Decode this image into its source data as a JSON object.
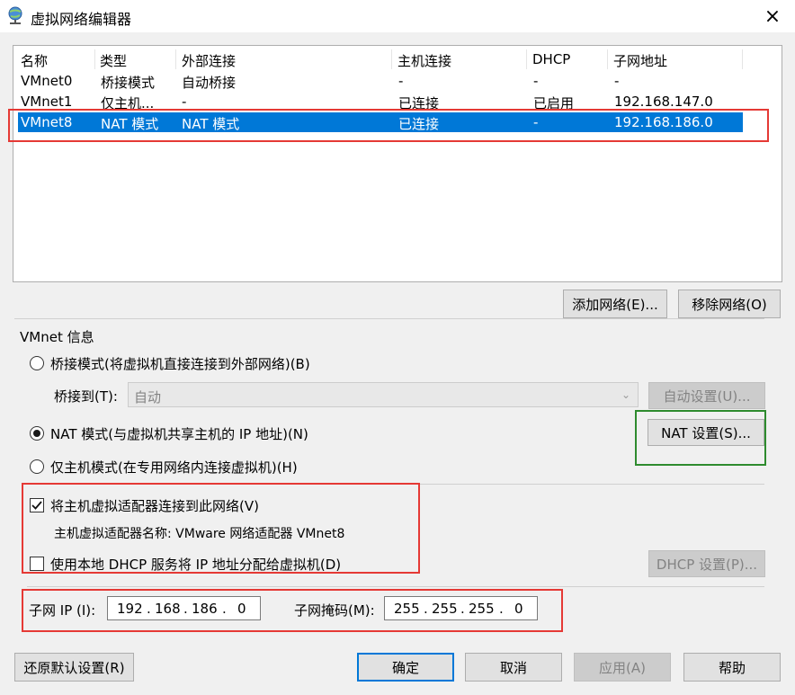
{
  "window": {
    "title": "虚拟网络编辑器",
    "close_icon": "×"
  },
  "table": {
    "headers": [
      "名称",
      "类型",
      "外部连接",
      "主机连接",
      "DHCP",
      "子网地址"
    ],
    "rows": [
      [
        "VMnet0",
        "桥接模式",
        "自动桥接",
        "-",
        "-",
        "-"
      ],
      [
        "VMnet1",
        "仅主机...",
        "-",
        "已连接",
        "已启用",
        "192.168.147.0"
      ],
      [
        "VMnet8",
        "NAT 模式",
        "NAT 模式",
        "已连接",
        "-",
        "192.168.186.0"
      ]
    ],
    "selected_index": 2
  },
  "buttons": {
    "add_network": "添加网络(E)...",
    "remove_network": "移除网络(O)",
    "auto_settings": "自动设置(U)...",
    "nat_settings": "NAT 设置(S)...",
    "dhcp_settings": "DHCP 设置(P)...",
    "restore_defaults": "还原默认设置(R)",
    "ok": "确定",
    "cancel": "取消",
    "apply": "应用(A)",
    "help": "帮助"
  },
  "vmnet_info": {
    "group_label": "VMnet 信息",
    "bridged_label": "桥接模式(将虚拟机直接连接到外部网络)(B)",
    "bridge_to_label": "桥接到(T):",
    "bridge_to_value": "自动",
    "nat_label": "NAT 模式(与虚拟机共享主机的 IP 地址)(N)",
    "hostonly_label": "仅主机模式(在专用网络内连接虚拟机)(H)",
    "selected_mode": "nat",
    "connect_adapter_label": "将主机虚拟适配器连接到此网络(V)",
    "connect_adapter_checked": true,
    "adapter_name_label": "主机虚拟适配器名称: VMware 网络适配器 VMnet8",
    "use_dhcp_label": "使用本地 DHCP 服务将 IP 地址分配给虚拟机(D)",
    "use_dhcp_checked": false,
    "subnet_ip_label": "子网 IP (I):",
    "subnet_ip": [
      "192",
      "168",
      "186",
      "0"
    ],
    "subnet_mask_label": "子网掩码(M):",
    "subnet_mask": [
      "255",
      "255",
      "255",
      "0"
    ]
  },
  "colors": {
    "selection": "#0078d7",
    "highlight_red": "#e53935",
    "highlight_green": "#2e8b2e"
  }
}
